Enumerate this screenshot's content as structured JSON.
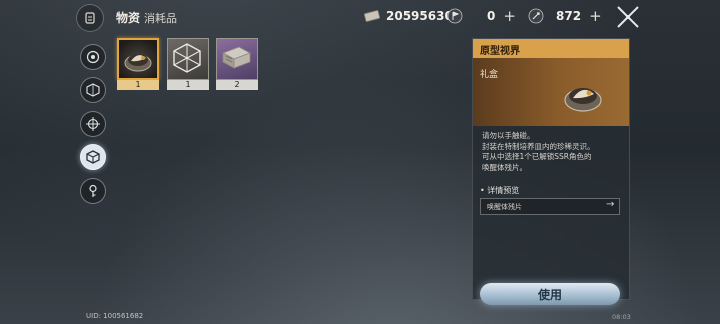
{
  "header": {
    "title": "物资",
    "subtitle": "消耗品",
    "currency_ticket": "20595630",
    "currency_flag": "0",
    "currency_stamina": "872",
    "plus": "+"
  },
  "nav": {
    "items": [
      "compass",
      "dice",
      "target",
      "cube",
      "key"
    ],
    "active": "cube"
  },
  "items": [
    {
      "icon": "gift-box-icon",
      "count": "1",
      "selected": true
    },
    {
      "icon": "wire-cube-icon",
      "count": "1",
      "selected": false
    },
    {
      "icon": "metal-tome-icon",
      "count": "2",
      "selected": false
    }
  ],
  "detail": {
    "header": "原型视界",
    "item_name": "礼盒",
    "description_lines": [
      "请勿以手触碰。",
      "封装在特制培养皿内的珍稀灵识。",
      "可从中选择1个已解锁SSR角色的",
      "唤醒体残片。"
    ],
    "detail_title": "• 详情预览",
    "detail_row": "唤醒体残片",
    "arrow": "→",
    "use_label": "使用"
  },
  "footer": {
    "uid": "UID: 100561682",
    "time": "08:03"
  },
  "colors": {
    "accent": "#d9a14b",
    "selected_border": "#e3a53f",
    "banner": "#8a5c2a"
  }
}
